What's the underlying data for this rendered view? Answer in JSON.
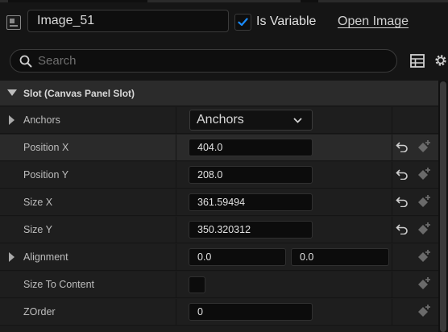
{
  "header": {
    "widget_icon": "image-widget-icon",
    "name_value": "Image_51",
    "is_variable_checked": true,
    "is_variable_label": "Is Variable",
    "open_image_label": "Open Image"
  },
  "search": {
    "placeholder": "Search",
    "icon": "search-icon"
  },
  "toolbar": {
    "table_icon": "table-icon",
    "settings_icon": "gear-icon"
  },
  "section": {
    "title": "Slot (Canvas Panel Slot)",
    "expanded": true
  },
  "rows": {
    "anchors": {
      "label": "Anchors",
      "value": "Anchors",
      "collapsed": true
    },
    "position_x": {
      "label": "Position X",
      "value": "404.0",
      "highlighted": true
    },
    "position_y": {
      "label": "Position Y",
      "value": "208.0"
    },
    "size_x": {
      "label": "Size X",
      "value": "361.59494"
    },
    "size_y": {
      "label": "Size Y",
      "value": "350.320312"
    },
    "alignment": {
      "label": "Alignment",
      "x": "0.0",
      "y": "0.0",
      "collapsed": true
    },
    "size_to_content": {
      "label": "Size To Content",
      "checked": false
    },
    "zorder": {
      "label": "ZOrder",
      "value": "0"
    }
  },
  "colors": {
    "accent_check": "#1a8cff",
    "background": "#151515",
    "panel": "#1e1e1e",
    "field": "#0c0c0c"
  }
}
